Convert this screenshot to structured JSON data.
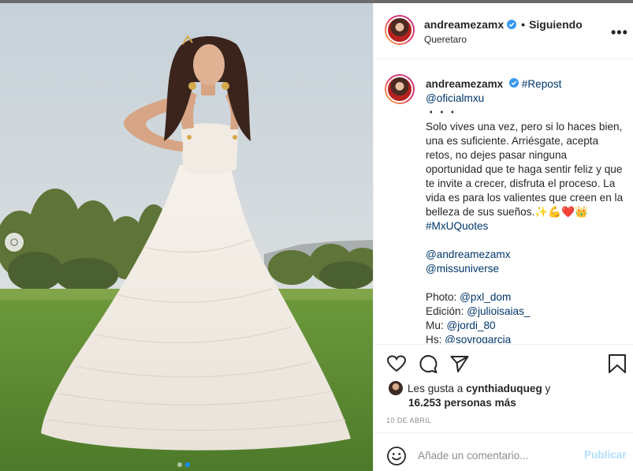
{
  "post": {
    "username": "andreamezamx",
    "follow_separator": "•",
    "follow_label": "Siguiendo",
    "location": "Queretaro",
    "more_label": "•••",
    "icons": {
      "verified": "verified-badge-icon",
      "more": "more-options-icon",
      "prev": "chevron-left-icon",
      "like": "heart-icon",
      "comment": "comment-icon",
      "share": "paper-plane-icon",
      "save": "bookmark-icon",
      "emoji": "smiley-icon"
    },
    "colors": {
      "link": "#00376b",
      "verified": "#3897f0",
      "publish_disabled": "#b2dffc",
      "active_dot": "#1a8cff"
    }
  },
  "caption": {
    "username": "andreamezamx",
    "tag_repost": "#Repost",
    "mention_source": "@oficialmxu",
    "dots": "・・・",
    "body": "Solo vives una vez, pero si lo haces bien, una es suficiente. Arriésgate, acepta retos, no dejes pasar ninguna oportunidad que te haga sentir feliz y que te invite a crecer, disfruta el proceso. La vida es para los valientes que creen en la belleza de sus sueños.",
    "emojis": "✨💪❤️👑",
    "hashtag": "#MxUQuotes",
    "mention_1": "@andreamezamx",
    "mention_2": "@missuniverse",
    "credit_photo_label": "Photo:",
    "credit_photo": "@pxl_dom",
    "credit_edit_label": "Edición:",
    "credit_edit": "@julioisaias_",
    "credit_mu_label": "Mu:",
    "credit_mu": "@jordi_80",
    "credit_hs_label": "Hs:",
    "credit_hs": "@soyrogarcia"
  },
  "likes": {
    "prefix": "Les gusta a",
    "first_user": "cynthiaduqueg",
    "conjunction": "y",
    "others": "16.253 personas más"
  },
  "date": "10 DE ABRIL",
  "comment": {
    "placeholder": "Añade un comentario...",
    "publish_label": "Publicar"
  },
  "carousel": {
    "slide_count": 2,
    "active_index": 1
  }
}
